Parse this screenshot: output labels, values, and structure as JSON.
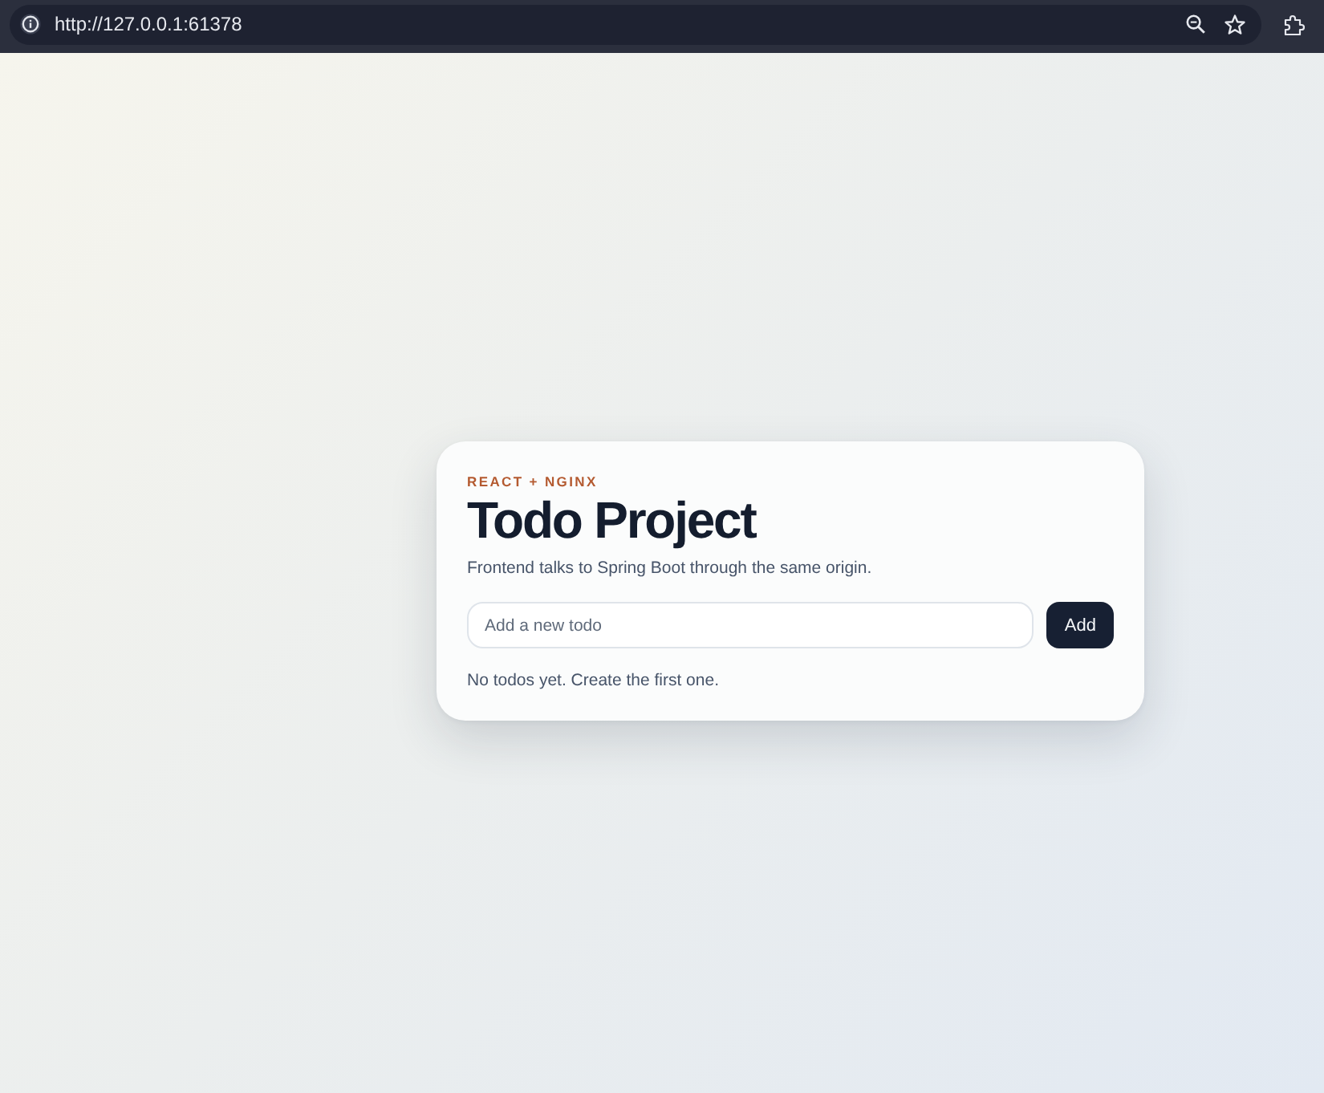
{
  "browser": {
    "url": "http://127.0.0.1:61378"
  },
  "card": {
    "eyebrow": "REACT + NGINX",
    "title": "Todo Project",
    "subtitle": "Frontend talks to Spring Boot through the same origin.",
    "new_todo": {
      "placeholder": "Add a new todo"
    },
    "add_button": "Add",
    "empty_message": "No todos yet. Create the first one."
  }
}
